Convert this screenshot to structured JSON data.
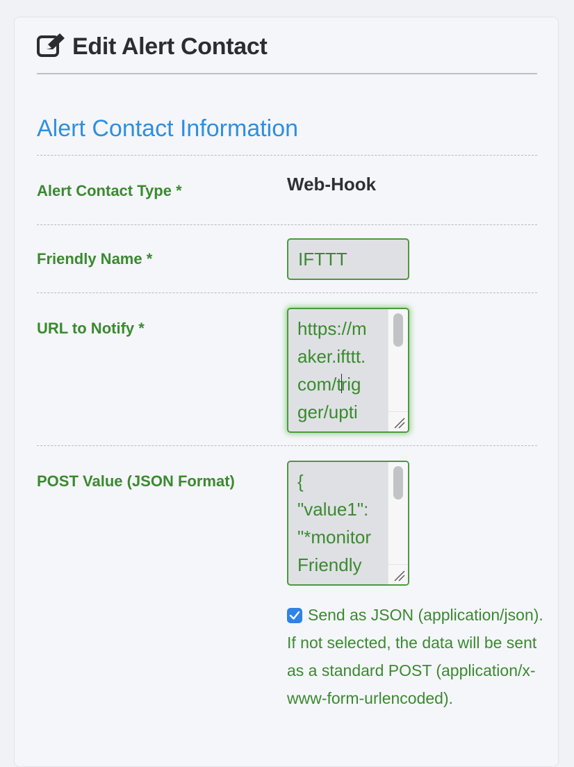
{
  "header": {
    "title": "Edit Alert Contact"
  },
  "section": {
    "title": "Alert Contact Information"
  },
  "fields": {
    "type": {
      "label": "Alert Contact Type *",
      "value": "Web-Hook"
    },
    "friendly_name": {
      "label": "Friendly Name *",
      "value": "IFTTT"
    },
    "url": {
      "label": "URL to Notify *",
      "lines": [
        "https://m",
        "aker.ifttt.",
        "com/trig",
        "ger/upti"
      ]
    },
    "post_value": {
      "label": "POST Value (JSON Format)",
      "lines": [
        "{",
        "\"value1\":",
        "\"*monitor",
        "Friendly"
      ]
    },
    "send_json": {
      "checked": true,
      "label": "Send as JSON (application/json). If not selected, the data will be sent as a standard POST (application/x-www-form-urlencoded)."
    }
  },
  "colors": {
    "accent_blue": "#2e8fe0",
    "label_green": "#3a8a2f",
    "checkbox_blue": "#2f82e6"
  },
  "icons": {
    "header": "edit-square-icon",
    "checkbox": "check-icon"
  }
}
